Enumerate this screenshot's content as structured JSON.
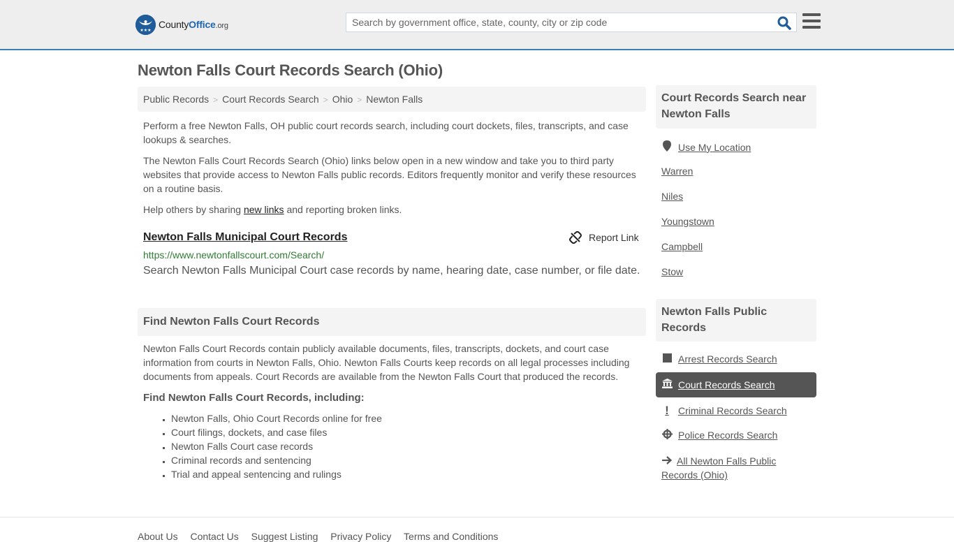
{
  "header": {
    "logo": {
      "name_part1": "County",
      "name_part2": "Office",
      "name_part3": ".org",
      "badge_glyph": "★★★"
    },
    "search": {
      "placeholder": "Search by government office, state, county, city or zip code",
      "value": ""
    },
    "icons": {
      "search": "search-icon",
      "menu": "hamburger-menu-icon"
    }
  },
  "page": {
    "title": "Newton Falls Court Records Search (Ohio)",
    "breadcrumb": [
      "Public Records",
      "Court Records Search",
      "Ohio",
      "Newton Falls"
    ],
    "breadcrumb_separator": ">",
    "intro": [
      "Perform a free Newton Falls, OH public court records search, including court dockets, files, transcripts, and case lookups & searches.",
      "The Newton Falls Court Records Search (Ohio) links below open in a new window and take you to third party websites that provide access to Newton Falls public records. Editors frequently monitor and verify these resources on a routine basis."
    ],
    "help": {
      "before": "Help others by sharing ",
      "link": "new links",
      "after": " and reporting broken links."
    }
  },
  "result": {
    "title": "Newton Falls Municipal Court Records",
    "url": "https://www.newtonfallscourt.com/Search/",
    "description": "Search Newton Falls Municipal Court case records by name, hearing date, case number, or file date.",
    "report_label": "Report Link"
  },
  "find_section": {
    "heading": "Find Newton Falls Court Records",
    "text": "Newton Falls Court Records contain publicly available documents, files, transcripts, dockets, and court case information from courts in Newton Falls, Ohio. Newton Falls Courts keep records on all legal processes including documents from appeals. Court Records are available from the Newton Falls Court that produced the records.",
    "subheading": "Find Newton Falls Court Records, including:",
    "items": [
      "Newton Falls, Ohio Court Records online for free",
      "Court filings, dockets, and case files",
      "Newton Falls Court case records",
      "Criminal records and sentencing",
      "Trial and appeal sentencing and rulings"
    ]
  },
  "sidebar": {
    "nearby": {
      "heading": "Court Records Search near Newton Falls",
      "use_location": "Use My Location",
      "cities": [
        "Warren",
        "Niles",
        "Youngstown",
        "Campbell",
        "Stow"
      ]
    },
    "public_records": {
      "heading": "Newton Falls Public Records",
      "items": [
        {
          "label": "Arrest Records Search",
          "icon": "square-icon",
          "active": false
        },
        {
          "label": "Court Records Search",
          "icon": "courthouse-icon",
          "active": true
        },
        {
          "label": "Criminal Records Search",
          "icon": "exclamation-icon",
          "active": false
        },
        {
          "label": "Police Records Search",
          "icon": "crosshair-icon",
          "active": false
        },
        {
          "label": "All Newton Falls Public Records (Ohio)",
          "icon": "arrow-right-icon",
          "active": false
        }
      ]
    }
  },
  "footer": {
    "links": [
      "About Us",
      "Contact Us",
      "Suggest Listing",
      "Privacy Policy",
      "Terms and Conditions"
    ]
  },
  "colors": {
    "header_bg": "#eeeeee",
    "header_border": "#3b7fb3",
    "brand_blue": "#1f5c99",
    "url_green": "#2f7d32",
    "panel_bg": "#f4f4f4",
    "active_bg": "#555555",
    "text": "#555555"
  }
}
